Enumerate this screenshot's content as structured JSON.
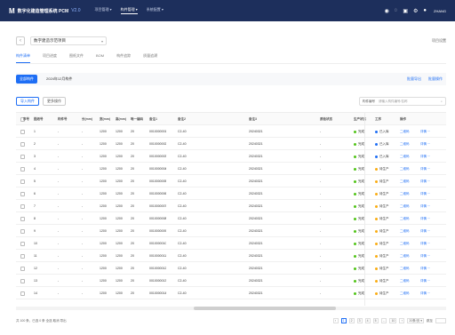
{
  "app": {
    "logo_text": "数字化建造管理系统 PCM",
    "version": "V2.0"
  },
  "topnav": [
    "项目管理",
    "构件管理",
    "系统配置"
  ],
  "topnav_active": 1,
  "user": {
    "name": "ZHANG"
  },
  "colors": {
    "topbar": "#1d2f5c",
    "accent": "#1e6ef5",
    "status_done": "#52c41a",
    "status_pending": "#faad14",
    "status_off": "#d9d9d9"
  },
  "project": {
    "name": "数字建造示范项目"
  },
  "crumb_right": "项目设置",
  "tabs": [
    "构件清单",
    "项目进度",
    "图纸文件",
    "BOM",
    "构件追踪",
    "质量追溯"
  ],
  "subtabs": {
    "chip_active": "全部构件",
    "chip2": "2024年12月构件",
    "right1": "批量导出",
    "right2": "批量操作"
  },
  "toolbar": {
    "import": "导入构件",
    "more": "更多操作",
    "search_placeholder": "请输入构件编号/名称",
    "search_type": "构件编号"
  },
  "table": {
    "headers": [
      "",
      "序号",
      "图纸号",
      "构件号",
      "长(mm)",
      "宽(mm)",
      "高(mm)",
      "唯一编码",
      "备注1",
      "备注2",
      "备注3",
      "质检状态",
      "生产状态",
      "工序",
      "操作"
    ],
    "rows": [
      [
        "1",
        "-",
        "-",
        "1200",
        "1200",
        "20",
        "0010000001",
        "C2-40",
        "20240321",
        "-",
        "完成",
        "已入库",
        "二维码",
        "详情"
      ],
      [
        "2",
        "-",
        "-",
        "1200",
        "1200",
        "20",
        "0010000002",
        "C2-40",
        "20240321",
        "-",
        "完成",
        "已入库",
        "二维码",
        "详情"
      ],
      [
        "3",
        "-",
        "-",
        "1200",
        "1200",
        "20",
        "0010000003",
        "C2-40",
        "20240321",
        "-",
        "完成",
        "已入库",
        "二维码",
        "详情"
      ],
      [
        "4",
        "-",
        "-",
        "1200",
        "1200",
        "20",
        "0010000004",
        "C2-40",
        "20240321",
        "-",
        "完成",
        "待生产",
        "二维码",
        "详情"
      ],
      [
        "5",
        "-",
        "-",
        "1200",
        "1200",
        "20",
        "0010000005",
        "C2-40",
        "20240321",
        "-",
        "完成",
        "待生产",
        "二维码",
        "详情"
      ],
      [
        "6",
        "-",
        "-",
        "1200",
        "1200",
        "20",
        "0010000006",
        "C2-40",
        "20240321",
        "-",
        "完成",
        "待生产",
        "二维码",
        "详情"
      ],
      [
        "7",
        "-",
        "-",
        "1200",
        "1200",
        "20",
        "0010000007",
        "C2-40",
        "20240321",
        "-",
        "完成",
        "待生产",
        "二维码",
        "详情"
      ],
      [
        "8",
        "-",
        "-",
        "1200",
        "1200",
        "20",
        "0010000008",
        "C2-40",
        "20240321",
        "-",
        "完成",
        "待生产",
        "二维码",
        "详情"
      ],
      [
        "9",
        "-",
        "-",
        "1200",
        "1200",
        "20",
        "0010000009",
        "C2-40",
        "20240321",
        "-",
        "完成",
        "待生产",
        "二维码",
        "详情"
      ],
      [
        "10",
        "-",
        "-",
        "1200",
        "1200",
        "20",
        "0010000010",
        "C2-40",
        "20240321",
        "-",
        "完成",
        "待生产",
        "二维码",
        "详情"
      ],
      [
        "11",
        "-",
        "-",
        "1200",
        "1200",
        "20",
        "0010000011",
        "C2-40",
        "20240321",
        "-",
        "完成",
        "待生产",
        "二维码",
        "详情"
      ],
      [
        "12",
        "-",
        "-",
        "1200",
        "1200",
        "20",
        "0010000012",
        "C2-40",
        "20240321",
        "-",
        "完成",
        "待生产",
        "二维码",
        "详情"
      ],
      [
        "13",
        "-",
        "-",
        "1200",
        "1200",
        "20",
        "0010000013",
        "C2-40",
        "20240321",
        "-",
        "完成",
        "待生产",
        "二维码",
        "详情"
      ],
      [
        "14",
        "-",
        "-",
        "1200",
        "1200",
        "20",
        "0010000014",
        "C2-40",
        "20240321",
        "-",
        "完成",
        "待生产",
        "二维码",
        "详情"
      ]
    ]
  },
  "footer": {
    "summary": "共 100 条，已选 0 条  全选  取消  导出",
    "pages": [
      "1",
      "2",
      "3",
      "4",
      "5",
      "...",
      "10"
    ],
    "page_size": "20条/页",
    "goto": "跳至"
  }
}
